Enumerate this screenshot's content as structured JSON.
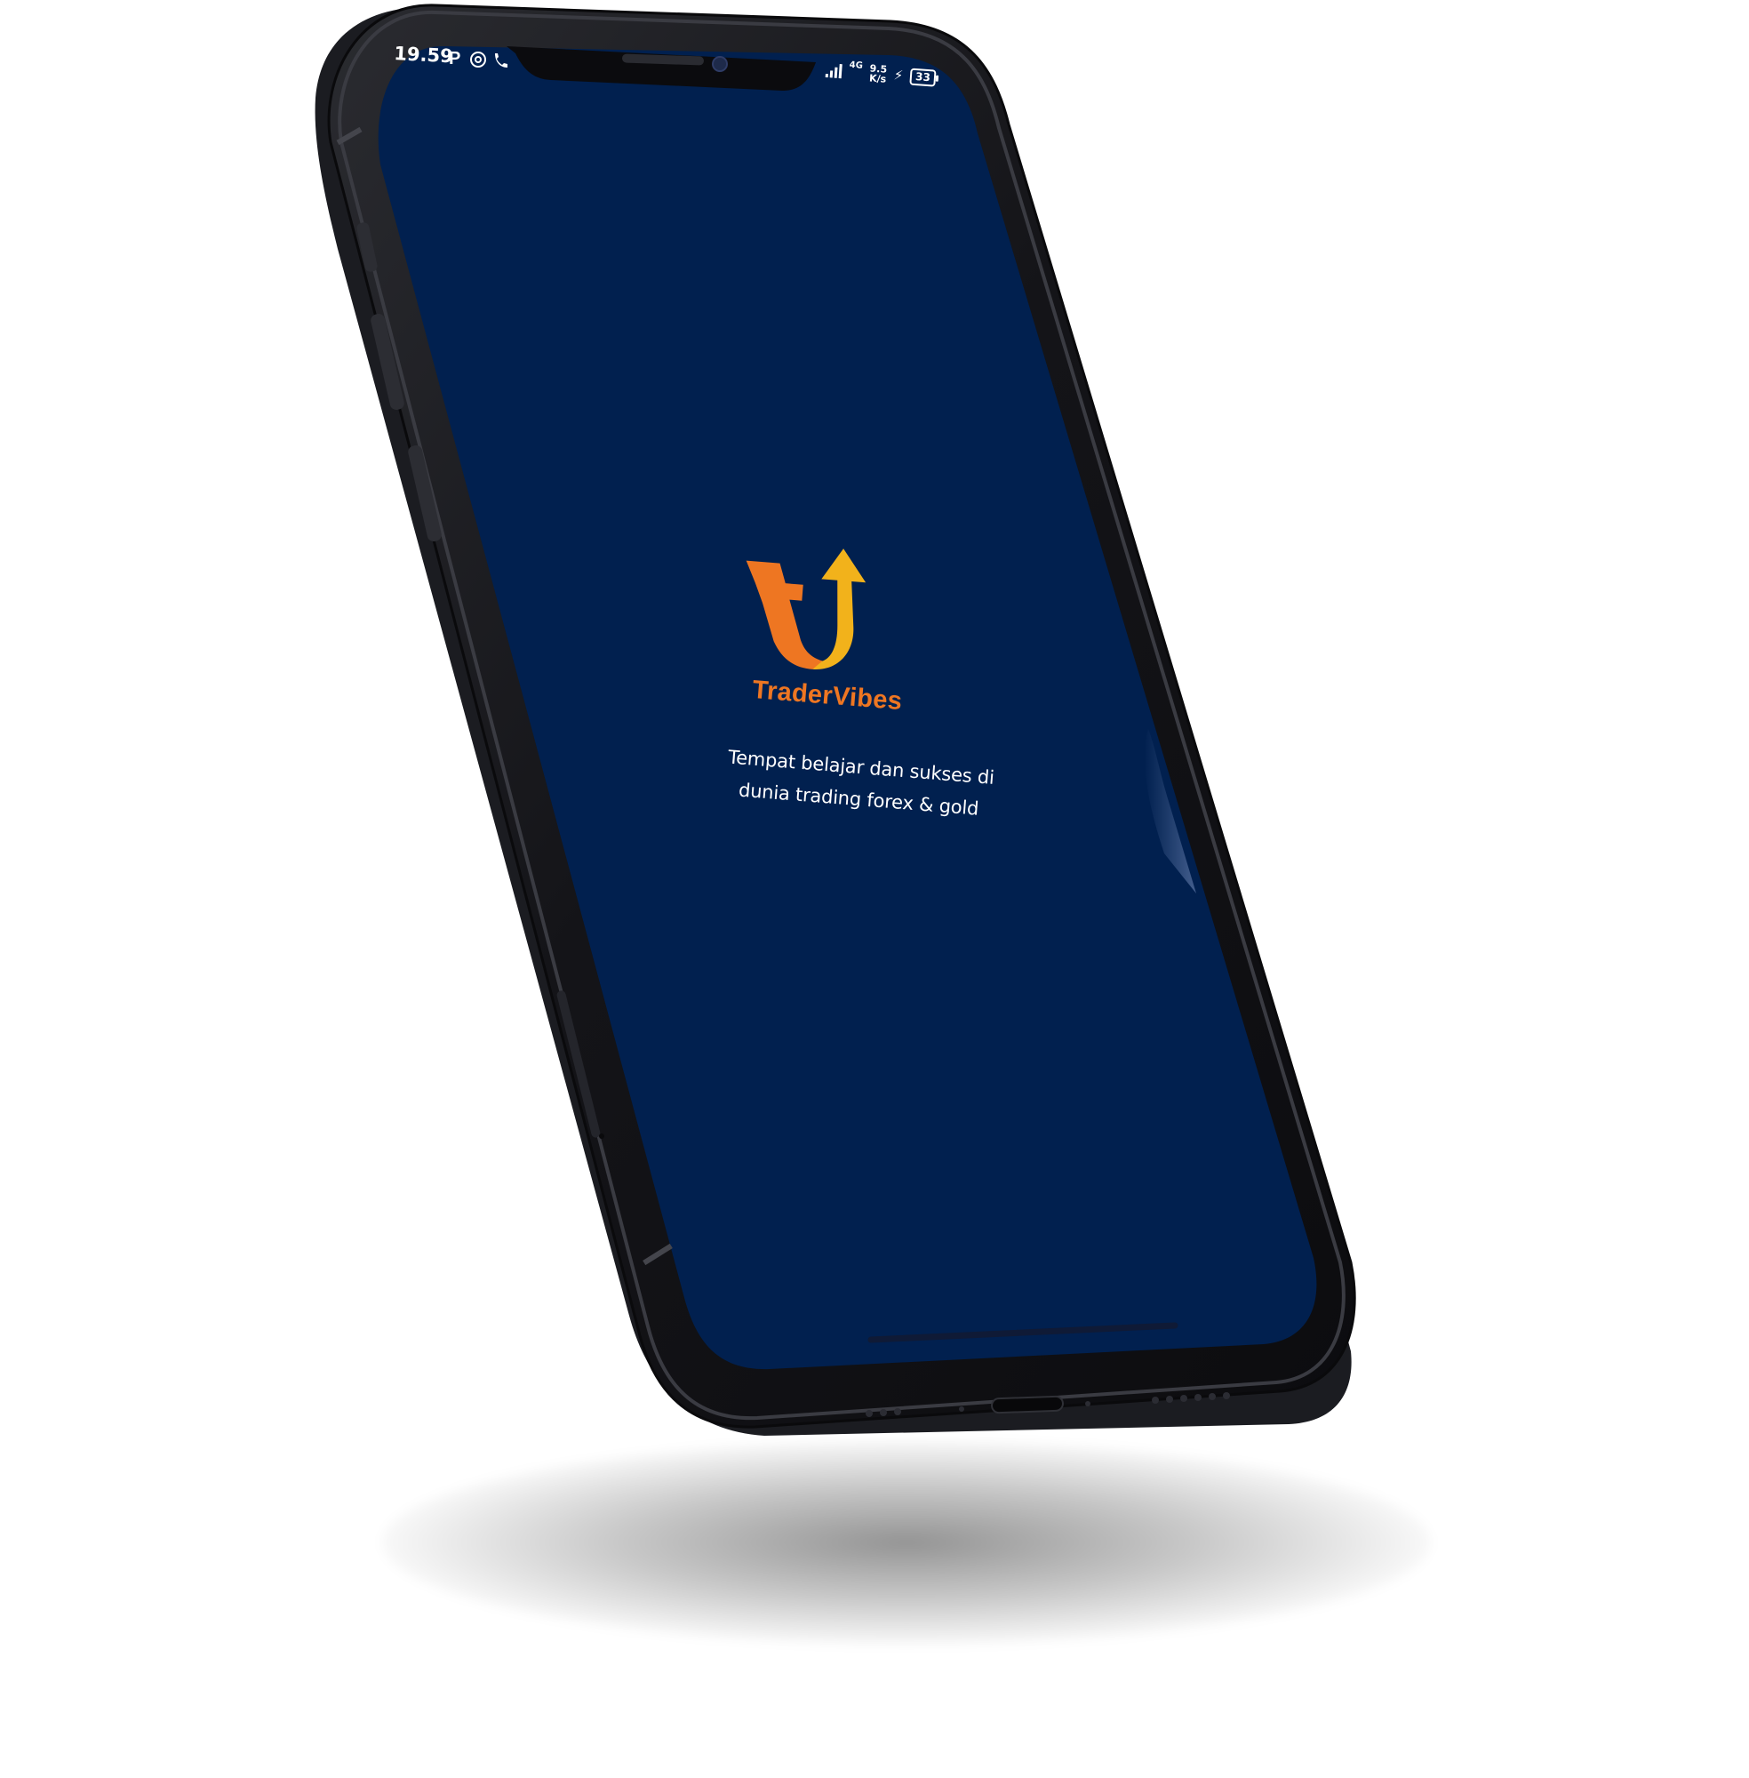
{
  "status_bar": {
    "time": "19.59",
    "network_type": "4G",
    "network_speed_value": "9.5",
    "network_speed_unit": "K/s",
    "battery_level": "33"
  },
  "splash": {
    "app_name": "TraderVibes",
    "tagline_line1": "Tempat belajar dan sukses di",
    "tagline_line2": "dunia trading forex & gold"
  },
  "colors": {
    "screen_background": "#01204f",
    "brand_orange": "#ee7622",
    "brand_yellow": "#f2b21b",
    "phone_body": "#151519"
  },
  "icons": {
    "status_left": [
      "parking-p-icon",
      "at-sign-icon",
      "phone-call-icon"
    ],
    "status_right": [
      "signal-strength-icon",
      "charging-bolt-icon",
      "battery-icon"
    ],
    "logo": "tradervibes-arrow-logo"
  }
}
